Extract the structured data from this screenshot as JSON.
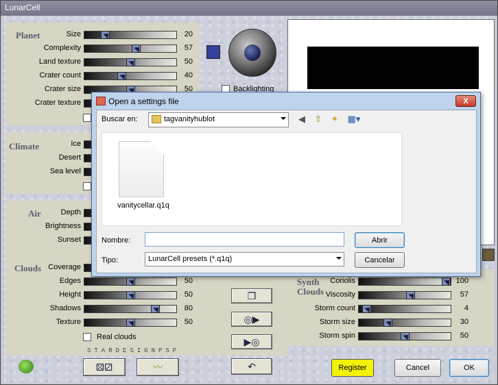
{
  "window": {
    "title": "LunarCell"
  },
  "planet": {
    "section": "Planet",
    "sliders": [
      {
        "label": "Size",
        "value": "20",
        "pct": 0.2
      },
      {
        "label": "Complexity",
        "value": "57",
        "pct": 0.57
      },
      {
        "label": "Land texture",
        "value": "50",
        "pct": 0.5
      },
      {
        "label": "Crater count",
        "value": "40",
        "pct": 0.4
      },
      {
        "label": "Crater size",
        "value": "50",
        "pct": 0.5
      },
      {
        "label": "Crater texture",
        "value": "",
        "pct": 0.5
      }
    ],
    "backlighting_label": "Backlighting",
    "color_swatch": "#33409c"
  },
  "climate": {
    "section": "Climate",
    "sliders": [
      {
        "label": "Ice"
      },
      {
        "label": "Desert"
      },
      {
        "label": "Sea level"
      }
    ]
  },
  "air": {
    "section": "Air",
    "sliders": [
      {
        "label": "Depth"
      },
      {
        "label": "Brightness"
      },
      {
        "label": "Sunset"
      }
    ]
  },
  "clouds": {
    "section": "Clouds",
    "sliders": [
      {
        "label": "Coverage",
        "value": "",
        "pct": 0.5
      },
      {
        "label": "Edges",
        "value": "50",
        "pct": 0.5
      },
      {
        "label": "Height",
        "value": "50",
        "pct": 0.5
      },
      {
        "label": "Shadows",
        "value": "80",
        "pct": 0.8
      },
      {
        "label": "Texture",
        "value": "50",
        "pct": 0.5
      }
    ],
    "real_clouds_label": "Real clouds",
    "watermark": "STARDESIGNPSP"
  },
  "synth": {
    "section_line1": "Synth",
    "section_line2": "Clouds",
    "sliders": [
      {
        "label": "Coriolis",
        "value": "100",
        "pct": 1.0
      },
      {
        "label": "Viscosity",
        "value": "57",
        "pct": 0.57
      },
      {
        "label": "Storm count",
        "value": "4",
        "pct": 0.04
      },
      {
        "label": "Storm size",
        "value": "30",
        "pct": 0.3
      },
      {
        "label": "Storm spin",
        "value": "50",
        "pct": 0.5
      }
    ]
  },
  "bottom_buttons": {
    "register": "Register",
    "cancel": "Cancel",
    "ok": "OK"
  },
  "dialog": {
    "title": "Open a settings file",
    "close": "X",
    "look_in_label": "Buscar en:",
    "look_in_value": "tagvanityhublot",
    "file": {
      "name": "vanitycellar.q1q"
    },
    "filename_label": "Nombre:",
    "filename_value": "",
    "type_label": "Tipo:",
    "type_value": "LunarCell presets (*.q1q)",
    "open_button": "Abrir",
    "cancel_button": "Cancelar"
  }
}
